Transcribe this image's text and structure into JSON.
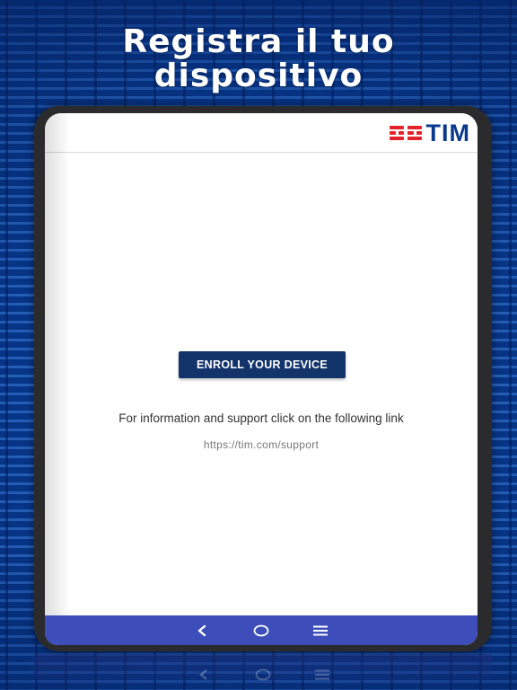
{
  "headline": {
    "line1": "Registra il tuo",
    "line2": "dispositivo"
  },
  "app": {
    "brand": {
      "logo_text": "TIM",
      "logo_mark_color": "#e32229",
      "logo_text_color": "#0b3a8c"
    },
    "enroll_button_label": "ENROLL YOUR DEVICE",
    "info_text": "For information and support click on the following link",
    "support_link": "https://tim.com/support"
  },
  "navigation_bar": {
    "color": "#3d4eba",
    "buttons": [
      {
        "icon": "back-icon",
        "glyph": "‹"
      },
      {
        "icon": "home-icon",
        "glyph": "○"
      },
      {
        "icon": "recents-icon",
        "glyph": "≡"
      }
    ]
  }
}
